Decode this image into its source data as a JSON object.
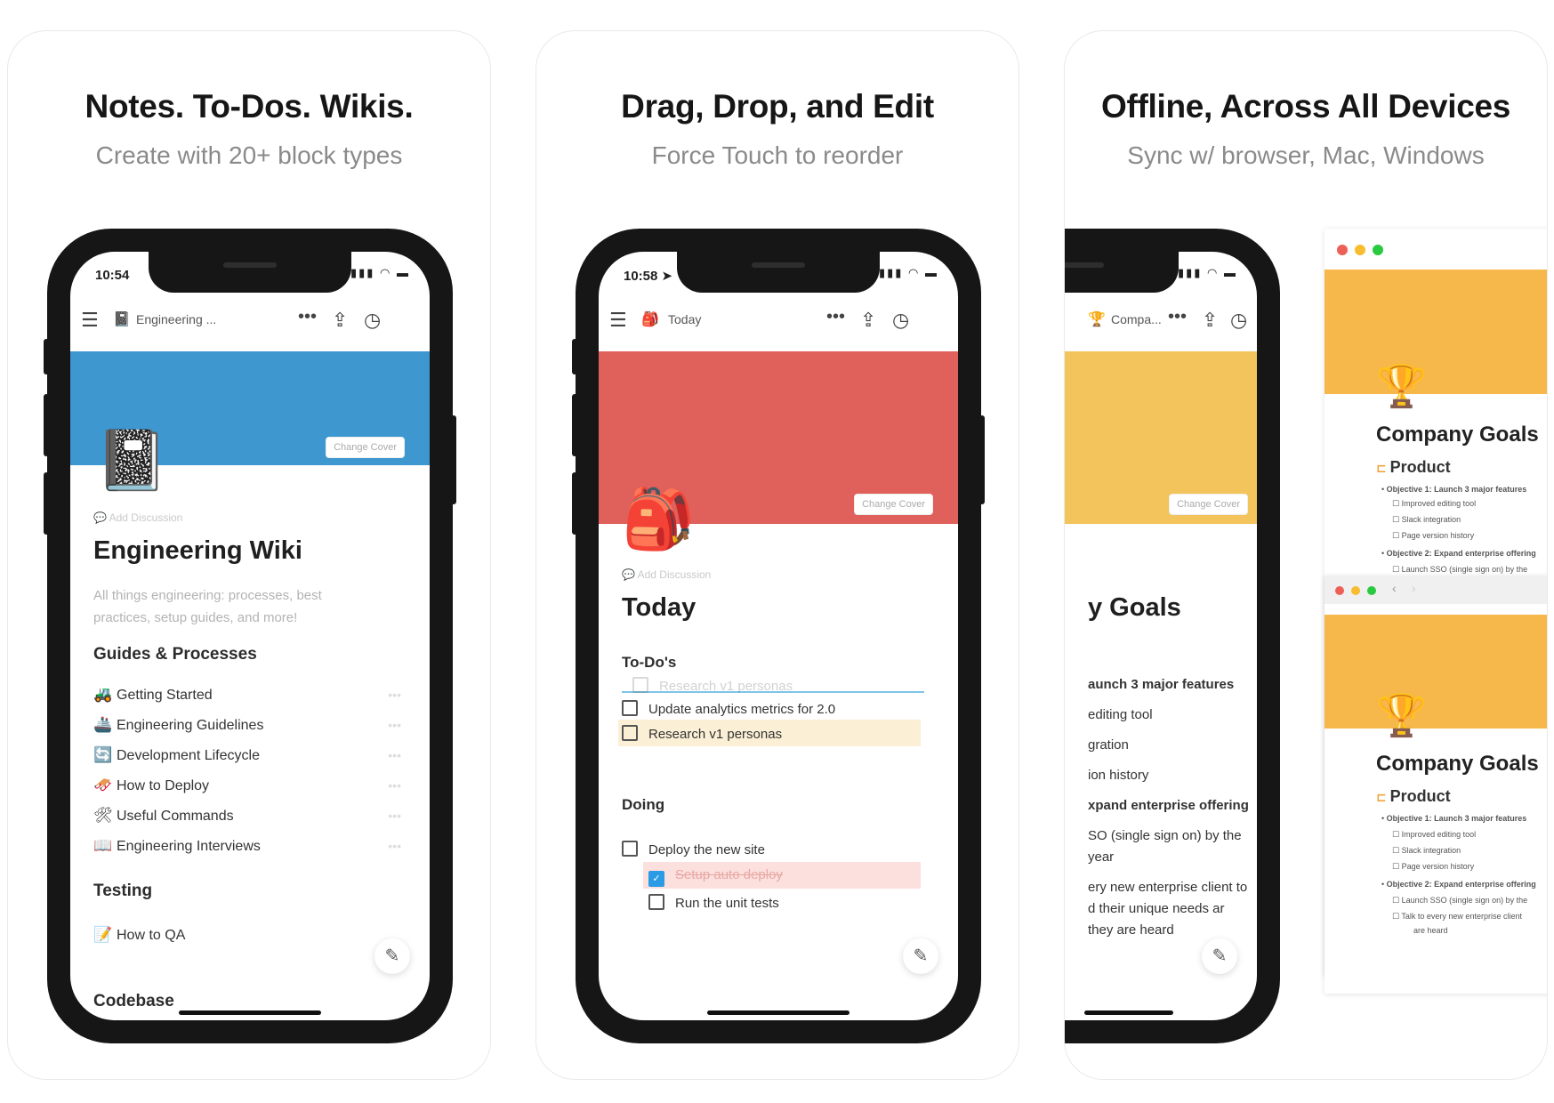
{
  "panels": [
    {
      "title": "Notes. To-Dos. Wikis.",
      "subtitle": "Create with 20+ block types"
    },
    {
      "title": "Drag, Drop, and Edit",
      "subtitle": "Force Touch to reorder"
    },
    {
      "title": "Offline, Across All Devices",
      "subtitle": "Sync w/ browser, Mac, Windows"
    }
  ],
  "phone1": {
    "time": "10:54",
    "breadcrumb": "Engineering ...",
    "cover_color": "#3f97d0",
    "change_cover": "Change Cover",
    "add_discussion": "Add Discussion",
    "title": "Engineering Wiki",
    "description": "All things engineering: processes, best practices, setup guides, and more!",
    "section1": "Guides & Processes",
    "items": [
      {
        "emoji": "🚜",
        "label": "Getting Started"
      },
      {
        "emoji": "🚢",
        "label": "Engineering Guidelines"
      },
      {
        "emoji": "🔄",
        "label": "Development Lifecycle"
      },
      {
        "emoji": "🛷",
        "label": "How to Deploy"
      },
      {
        "emoji": "🛠",
        "label": "Useful Commands"
      },
      {
        "emoji": "📖",
        "label": "Engineering Interviews"
      }
    ],
    "section2": "Testing",
    "testing_items": [
      {
        "emoji": "📝",
        "label": "How to QA"
      }
    ],
    "section3": "Codebase"
  },
  "phone2": {
    "time": "10:58",
    "breadcrumb": "Today",
    "cover_color": "#e0605b",
    "change_cover": "Change Cover",
    "add_discussion": "Add Discussion",
    "title": "Today",
    "section1": "To-Do's",
    "dragging_item": "Research v1 personas",
    "todos": [
      {
        "label": "Update analytics metrics for 2.0",
        "checked": false
      },
      {
        "label": "Research v1 personas",
        "checked": false
      }
    ],
    "section2": "Doing",
    "doing": [
      {
        "label": "Deploy the new site",
        "checked": false
      },
      {
        "label": "Setup auto deploy",
        "checked": true
      },
      {
        "label": "Run the unit tests",
        "checked": false
      }
    ]
  },
  "phone3": {
    "breadcrumb": "Compa...",
    "cover_color": "#f3c35c",
    "change_cover": "Change Cover",
    "title_fragment": "y Goals",
    "lines": [
      "aunch 3 major features",
      "editing tool",
      "gration",
      "ion history",
      "xpand enterprise offering",
      "SO (single sign on) by the",
      "year",
      "ery new enterprise client to",
      "d their unique needs ar",
      "they are heard"
    ]
  },
  "desktop": {
    "title": "Company Goals",
    "section": "Product",
    "lines": [
      "Objective 1: Launch 3 major features",
      "Improved editing tool",
      "Slack integration",
      "Page version history",
      "Objective 2: Expand enterprise offering",
      "Launch SSO (single sign on) by the",
      "Talk to every new enterprise client"
    ],
    "lines2_end": "are heard"
  }
}
